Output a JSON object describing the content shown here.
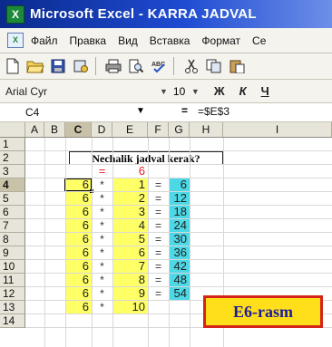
{
  "window": {
    "title": "Microsoft Excel - KARRA JADVAL"
  },
  "menu": [
    "Файл",
    "Правка",
    "Вид",
    "Вставка",
    "Формат",
    "Се"
  ],
  "format_bar": {
    "font": "Arial Cyr",
    "size": "10",
    "bold": "Ж",
    "italic": "К",
    "underline": "Ч"
  },
  "formula_bar": {
    "cell_ref": "C4",
    "equals": "=",
    "content": "=$E$3"
  },
  "grid": {
    "columns": [
      "A",
      "B",
      "C",
      "D",
      "E",
      "F",
      "G",
      "H",
      "I"
    ],
    "rows": [
      "1",
      "2",
      "3",
      "4",
      "5",
      "6",
      "7",
      "8",
      "9",
      "10",
      "11",
      "12",
      "13",
      "14"
    ],
    "selected_column": "C",
    "selected_row": "4",
    "title_text": "Nechalik jadval kerak?",
    "row3": {
      "d": "=",
      "e": "6"
    },
    "table": [
      {
        "c": "6",
        "d": "*",
        "e": "1",
        "f": "=",
        "g": "6"
      },
      {
        "c": "6",
        "d": "*",
        "e": "2",
        "f": "=",
        "g": "12"
      },
      {
        "c": "6",
        "d": "*",
        "e": "3",
        "f": "=",
        "g": "18"
      },
      {
        "c": "6",
        "d": "*",
        "e": "4",
        "f": "=",
        "g": "24"
      },
      {
        "c": "6",
        "d": "*",
        "e": "5",
        "f": "=",
        "g": "30"
      },
      {
        "c": "6",
        "d": "*",
        "e": "6",
        "f": "=",
        "g": "36"
      },
      {
        "c": "6",
        "d": "*",
        "e": "7",
        "f": "=",
        "g": "42"
      },
      {
        "c": "6",
        "d": "*",
        "e": "8",
        "f": "=",
        "g": "48"
      },
      {
        "c": "6",
        "d": "*",
        "e": "9",
        "f": "=",
        "g": "54"
      },
      {
        "c": "6",
        "d": "*",
        "e": "10",
        "f": "",
        "g": ""
      }
    ]
  },
  "caption": "E6-rasm",
  "colors": {
    "title_bar": "#1f4bd2",
    "yellow_fill": "#ffff66",
    "cyan_fill": "#4dd8e6",
    "red_text": "#e8202a",
    "caption_fill": "#ffdf1a",
    "caption_border": "#d4241a",
    "caption_text": "#1b1b9e"
  }
}
